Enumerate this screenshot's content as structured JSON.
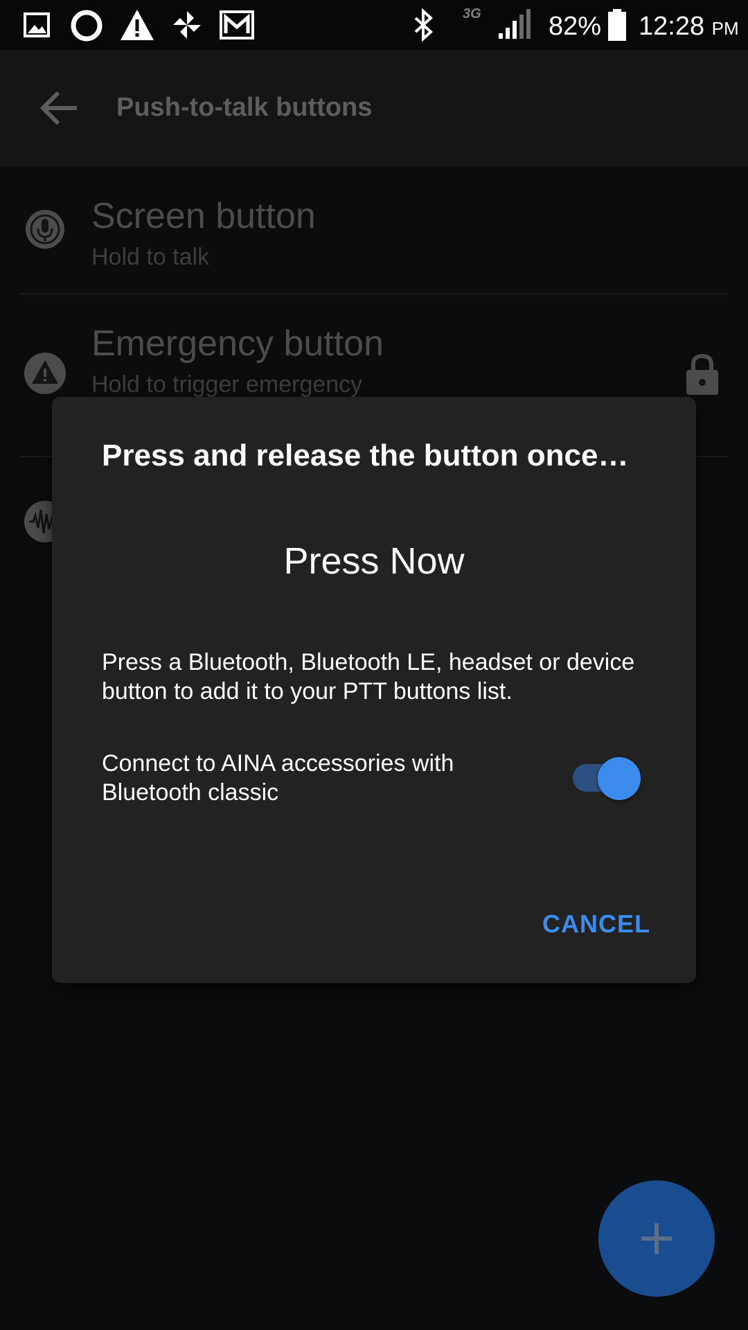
{
  "status_bar": {
    "battery_percent": "82%",
    "time": "12:28",
    "ampm": "PM",
    "network": "3G",
    "icons": [
      "image-icon",
      "ring-icon",
      "warning-icon",
      "pinwheel-icon",
      "mail-icon",
      "bluetooth-icon",
      "signal-icon",
      "battery-icon"
    ]
  },
  "app_bar": {
    "title": "Push-to-talk buttons",
    "back_icon": "arrow-back-icon"
  },
  "list": {
    "items": [
      {
        "title": "Screen button",
        "subtitle": "Hold to talk",
        "icon": "mic-icon"
      },
      {
        "title": "Emergency button",
        "subtitle": "Hold to trigger emergency",
        "icon": "warning-icon",
        "trailing_icon": "lock-icon"
      },
      {
        "icon": "waveform-icon"
      }
    ]
  },
  "dialog": {
    "title": "Press and release the button once…",
    "press_now": "Press Now",
    "body": "Press a Bluetooth, Bluetooth LE, headset or device button to add it to your PTT buttons list.",
    "toggle_label": "Connect to AINA accessories with Bluetooth classic",
    "toggle_on": true,
    "cancel_label": "CANCEL"
  },
  "fab": {
    "icon": "plus-icon"
  },
  "colors": {
    "accent": "#3b8cec",
    "fab": "#194d8f",
    "dialog_bg": "#222223",
    "background": "#0b0c0d"
  }
}
